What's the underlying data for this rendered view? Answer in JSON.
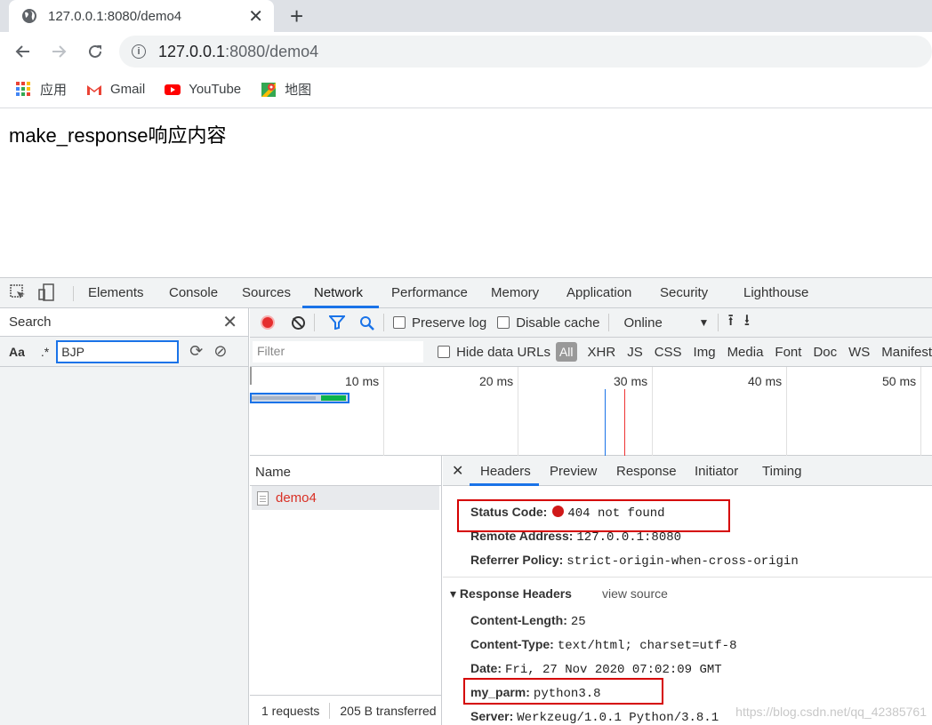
{
  "browser": {
    "tab_title": "127.0.0.1:8080/demo4",
    "tab_close": "✕",
    "new_tab": "+",
    "url_host": "127.0.0.1",
    "url_path": ":8080/demo4",
    "bookmarks": [
      {
        "label": "应用",
        "icon": "apps-grid-icon"
      },
      {
        "label": "Gmail",
        "icon": "gmail-icon"
      },
      {
        "label": "YouTube",
        "icon": "youtube-icon"
      },
      {
        "label": "地图",
        "icon": "maps-icon"
      }
    ]
  },
  "page": {
    "body_text": "make_response响应内容"
  },
  "devtools": {
    "tabs": [
      "Elements",
      "Console",
      "Sources",
      "Network",
      "Performance",
      "Memory",
      "Application",
      "Security",
      "Lighthouse"
    ],
    "active_tab": "Network",
    "search": {
      "title": "Search",
      "case_label": "Aa",
      "regex_label": ".*",
      "query": "BJP"
    },
    "network_toolbar": {
      "preserve_log": "Preserve log",
      "disable_cache": "Disable cache",
      "throttle": "Online",
      "throttle_arrow": "▼"
    },
    "filter_bar": {
      "placeholder": "Filter",
      "hide_data_urls": "Hide data URLs",
      "types": [
        "All",
        "XHR",
        "JS",
        "CSS",
        "Img",
        "Media",
        "Font",
        "Doc",
        "WS",
        "Manifest"
      ]
    },
    "overview": {
      "ticks": [
        "10 ms",
        "20 ms",
        "30 ms",
        "40 ms",
        "50 ms"
      ]
    },
    "requests": {
      "column_name": "Name",
      "rows": [
        {
          "name": "demo4"
        }
      ],
      "summary_count": "1 requests",
      "summary_transferred": "205 B transferred"
    },
    "details": {
      "tabs": [
        "Headers",
        "Preview",
        "Response",
        "Initiator",
        "Timing"
      ],
      "active_tab": "Headers",
      "close": "✕",
      "general": {
        "status_code_label": "Status Code:",
        "status_code_value": "404 not found",
        "remote_address_label": "Remote Address:",
        "remote_address_value": "127.0.0.1:8080",
        "referrer_policy_label": "Referrer Policy:",
        "referrer_policy_value": "strict-origin-when-cross-origin"
      },
      "response_headers": {
        "title": "▾ Response Headers",
        "view_source": "view source",
        "items": [
          {
            "k": "Content-Length:",
            "v": "25"
          },
          {
            "k": "Content-Type:",
            "v": "text/html; charset=utf-8"
          },
          {
            "k": "Date:",
            "v": "Fri, 27 Nov 2020 07:02:09 GMT"
          },
          {
            "k": "my_parm:",
            "v": "python3.8"
          },
          {
            "k": "Server:",
            "v": "Werkzeug/1.0.1 Python/3.8.1"
          }
        ]
      }
    }
  },
  "watermark": "https://blog.csdn.net/qq_42385761",
  "colors": {
    "accent": "#1a73e8",
    "status_error": "#d01919",
    "highlight_box": "#d50000",
    "request_error_text": "#d93025"
  }
}
